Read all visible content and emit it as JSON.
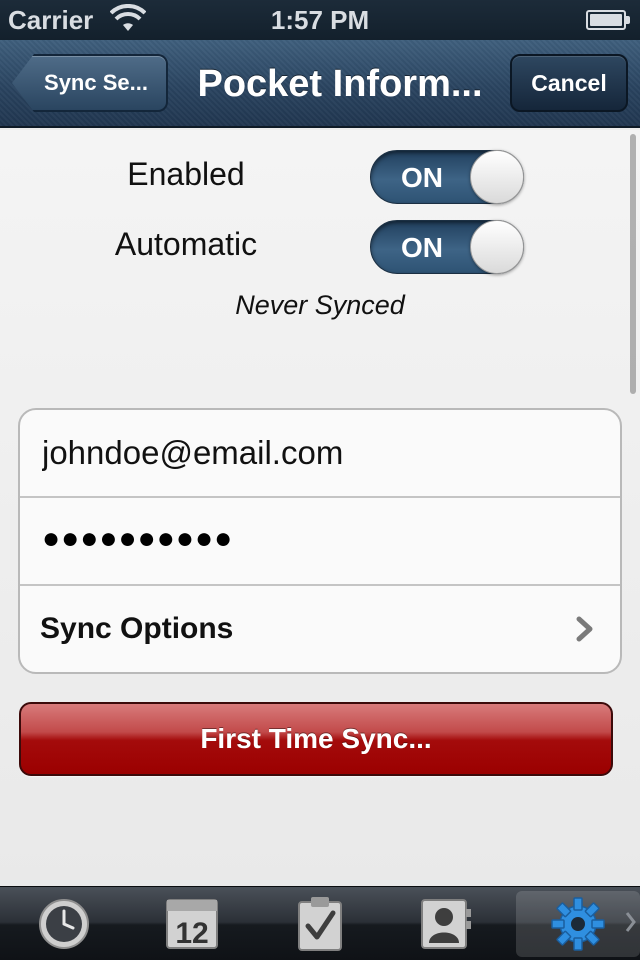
{
  "status_bar": {
    "carrier": "Carrier",
    "time": "1:57 PM"
  },
  "nav": {
    "back_label": "Sync Se...",
    "title": "Pocket Inform...",
    "cancel_label": "Cancel"
  },
  "settings": {
    "enabled": {
      "label": "Enabled",
      "state": "ON"
    },
    "automatic": {
      "label": "Automatic",
      "state": "ON"
    },
    "sync_status": "Never Synced"
  },
  "account": {
    "email_value": "johndoe@email.com",
    "password_masked": "●●●●●●●●●●",
    "sync_options_label": "Sync Options"
  },
  "actions": {
    "first_sync_label": "First Time Sync..."
  },
  "tab_bar": {
    "calendar_day": "12",
    "tabs": [
      "clock-icon",
      "calendar-icon",
      "tasks-icon",
      "contacts-icon",
      "settings-gear-icon"
    ],
    "active_tab": "settings-gear-icon"
  },
  "colors": {
    "nav_blue": "#2a4460",
    "switch_blue": "#2e5374",
    "button_red": "#9b0000",
    "gear_blue": "#2f8fe0"
  }
}
